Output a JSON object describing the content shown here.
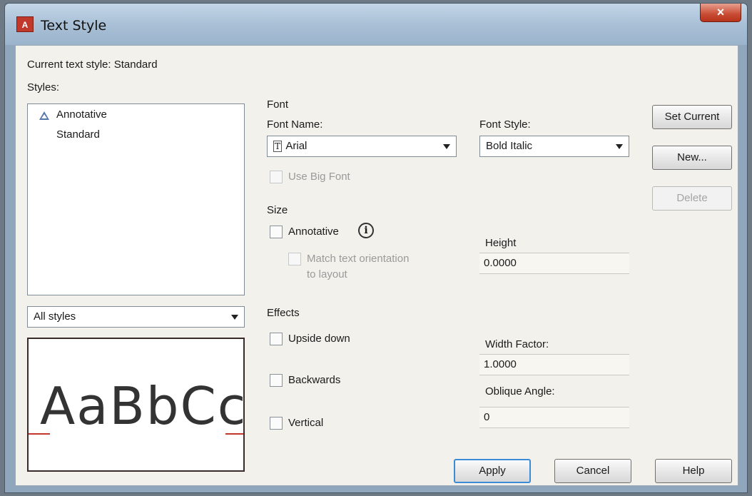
{
  "window": {
    "title": "Text Style",
    "app_icon": "A",
    "close_glyph": "×"
  },
  "current_style": "Current text style:  Standard",
  "styles": {
    "label": "Styles:",
    "items": [
      {
        "label": "Annotative",
        "icon": "annotative-triangle-icon"
      },
      {
        "label": "Standard"
      }
    ],
    "filter_value": "All styles"
  },
  "preview": {
    "text": "AaBbCc",
    "baseline_color": "#c0392b"
  },
  "font": {
    "group_label": "Font",
    "name_label": "Font Name:",
    "name_value": "Arial",
    "name_icon": "T",
    "style_label": "Font Style:",
    "style_value": "Bold Italic",
    "big_font_label": "Use Big Font"
  },
  "size": {
    "group_label": "Size",
    "annotative_label": "Annotative",
    "match_line1": "Match text orientation",
    "match_line2": "to layout",
    "height_label": "Height",
    "height_value": "0.0000"
  },
  "effects": {
    "group_label": "Effects",
    "upside_down_label": "Upside down",
    "backwards_label": "Backwards",
    "vertical_label": "Vertical",
    "width_factor_label": "Width Factor:",
    "width_factor_value": "1.0000",
    "oblique_label": "Oblique Angle:",
    "oblique_value": "0"
  },
  "buttons": {
    "set_current": "Set Current",
    "new": "New...",
    "delete": "Delete",
    "apply": "Apply",
    "cancel": "Cancel",
    "help": "Help"
  }
}
